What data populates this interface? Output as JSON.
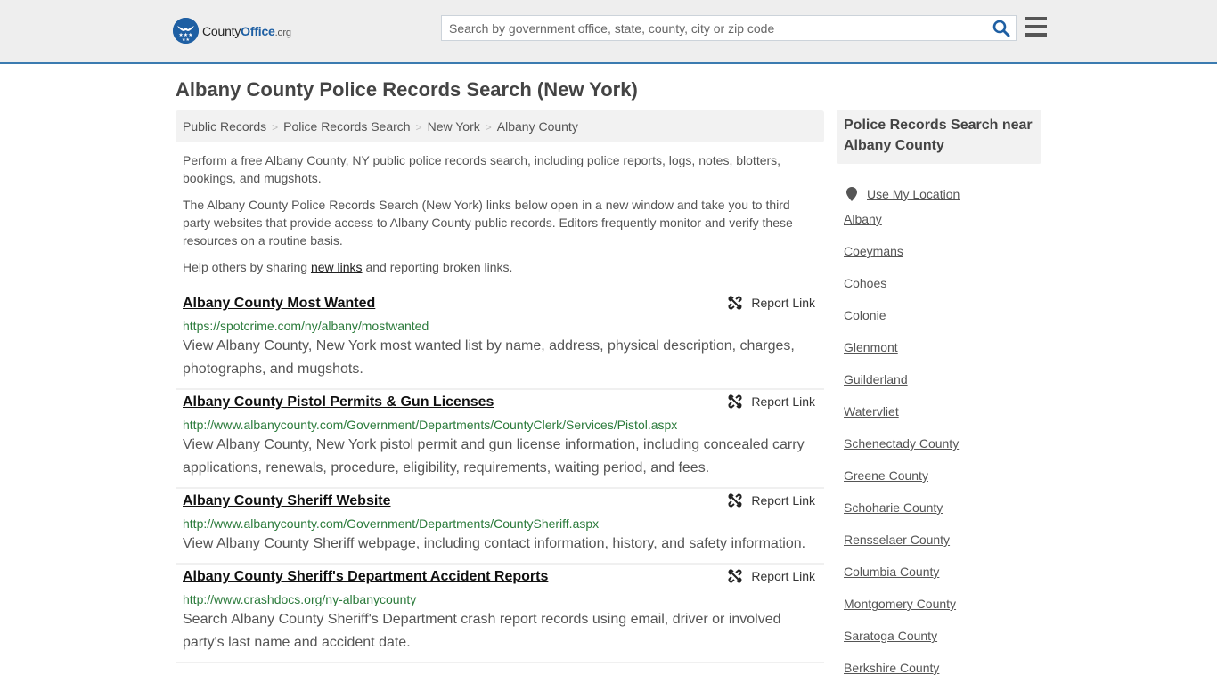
{
  "header": {
    "logo": {
      "name_part1": "County",
      "name_part2": "Office",
      "suffix": ".org"
    },
    "search": {
      "placeholder": "Search by government office, state, county, city or zip code",
      "value": ""
    },
    "icons": {
      "search": "search-icon",
      "menu": "hamburger-menu-icon"
    },
    "accent_color": "#3b7bb0"
  },
  "page": {
    "title": "Albany County Police Records Search (New York)"
  },
  "breadcrumb": [
    {
      "label": "Public Records"
    },
    {
      "label": "Police Records Search"
    },
    {
      "label": "New York"
    },
    {
      "label": "Albany County"
    }
  ],
  "intro": {
    "p1": "Perform a free Albany County, NY public police records search, including police reports, logs, notes, blotters, bookings, and mugshots.",
    "p2": "The Albany County Police Records Search (New York) links below open in a new window and take you to third party websites that provide access to Albany County public records. Editors frequently monitor and verify these resources on a routine basis.",
    "p3_before": "Help others by sharing ",
    "p3_link": "new links",
    "p3_after": " and reporting broken links."
  },
  "results": [
    {
      "title": "Albany County Most Wanted",
      "url": "https://spotcrime.com/ny/albany/mostwanted",
      "description": "View Albany County, New York most wanted list by name, address, physical description, charges, photographs, and mugshots.",
      "report_label": "Report Link"
    },
    {
      "title": "Albany County Pistol Permits & Gun Licenses",
      "url": "http://www.albanycounty.com/Government/Departments/CountyClerk/Services/Pistol.aspx",
      "description": "View Albany County, New York pistol permit and gun license information, including concealed carry applications, renewals, procedure, eligibility, requirements, waiting period, and fees.",
      "report_label": "Report Link"
    },
    {
      "title": "Albany County Sheriff Website",
      "url": "http://www.albanycounty.com/Government/Departments/CountySheriff.aspx",
      "description": "View Albany County Sheriff webpage, including contact information, history, and safety information.",
      "report_label": "Report Link"
    },
    {
      "title": "Albany County Sheriff's Department Accident Reports",
      "url": "http://www.crashdocs.org/ny-albanycounty",
      "description": "Search Albany County Sheriff's Department crash report records using email, driver or involved party's last name and accident date.",
      "report_label": "Report Link"
    }
  ],
  "sidebar": {
    "heading": "Police Records Search near Albany County",
    "use_location": "Use My Location",
    "links": [
      "Albany",
      "Coeymans",
      "Cohoes",
      "Colonie",
      "Glenmont",
      "Guilderland",
      "Watervliet",
      "Schenectady County",
      "Greene County",
      "Schoharie County",
      "Rensselaer County",
      "Columbia County",
      "Montgomery County",
      "Saratoga County",
      "Berkshire County"
    ]
  }
}
